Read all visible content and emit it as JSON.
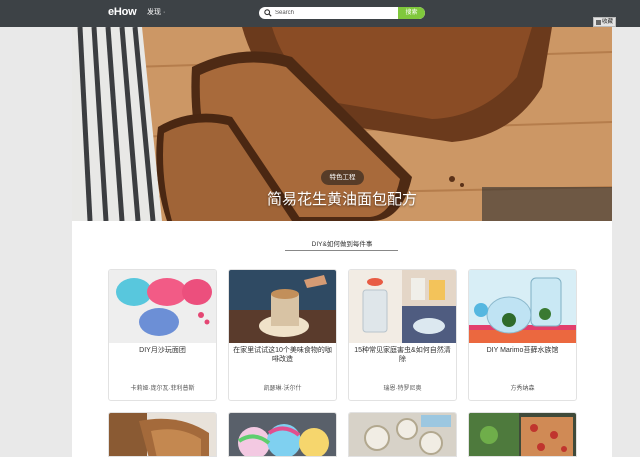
{
  "header": {
    "logo": "eHow",
    "discover_label": "发现 ·",
    "search_placeholder": "Search",
    "search_button": "搜索",
    "favorites_label": "收藏"
  },
  "hero": {
    "tag": "特色工程",
    "title": "简易花生黄油面包配方"
  },
  "section": {
    "title": "DIY&如何做到每件事"
  },
  "cards": [
    {
      "title": "DIY月沙玩面团",
      "author": "卡莉娅·庞尔瓦·菲利普斯"
    },
    {
      "title": "在家里试试这10个美味食物的咖啡改造",
      "author": "凯瑟琳·沃尔什"
    },
    {
      "title": "15种常见家庭害虫&如何自然清除",
      "author": "瑞恩·特罗尼奥"
    },
    {
      "title": "DIY Marimo苔藓水族馆",
      "author": "方秀纳森"
    }
  ]
}
